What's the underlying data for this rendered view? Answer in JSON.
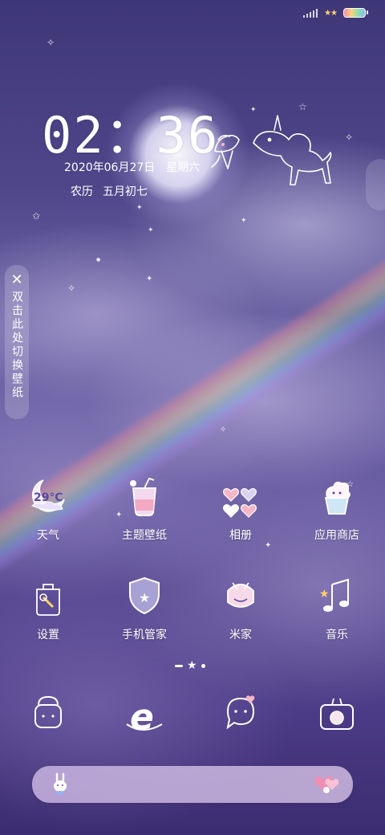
{
  "status_bar": {
    "icons": [
      "signal-icon",
      "stars-icon",
      "battery-icon"
    ]
  },
  "lock": {
    "time": "02：36",
    "date": "2020年06月27日",
    "weekday": "星期六",
    "lunar_label": "农历",
    "lunar_date": "五月初七"
  },
  "wallpaper_switch": {
    "close_glyph": "✕",
    "label": "双击此处切换壁纸"
  },
  "apps_row1": [
    {
      "label": "天气",
      "icon": "weather-moon-icon",
      "badge": "29℃"
    },
    {
      "label": "主题壁纸",
      "icon": "theme-drink-icon"
    },
    {
      "label": "相册",
      "icon": "gallery-hearts-icon"
    },
    {
      "label": "应用商店",
      "icon": "app-store-icecream-icon"
    }
  ],
  "apps_row2": [
    {
      "label": "设置",
      "icon": "settings-icon"
    },
    {
      "label": "手机管家",
      "icon": "security-shield-icon"
    },
    {
      "label": "米家",
      "icon": "mijia-icon"
    },
    {
      "label": "音乐",
      "icon": "music-note-icon"
    }
  ],
  "dock": [
    {
      "icon": "phone-bunny-icon"
    },
    {
      "icon": "browser-e-icon"
    },
    {
      "icon": "messages-ghost-icon"
    },
    {
      "icon": "camera-bunny-icon"
    }
  ],
  "search_bar": {
    "left_icon": "bunny-icon",
    "right_icon": "heart-bunny-icon"
  },
  "colors": {
    "accent_pink": "#f4b6c6",
    "accent_yellow": "#ffd36b",
    "bg_top": "#3e3777",
    "bg_bottom": "#3c2c70"
  }
}
